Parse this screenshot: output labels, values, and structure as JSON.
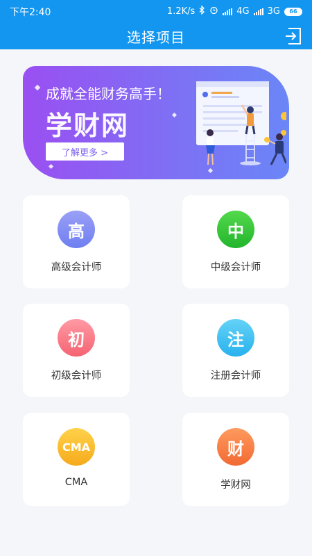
{
  "status": {
    "time": "下午2:40",
    "speed": "1.2K/s",
    "net1": "4G",
    "net2": "3G",
    "battery": "66"
  },
  "header": {
    "title": "选择项目"
  },
  "banner": {
    "headline": "成就全能财务高手！",
    "brand": "学财网",
    "button_label": "了解更多 >"
  },
  "items": [
    {
      "label": "高级会计师",
      "glyph": "高",
      "color_top": "#9aa0f6",
      "color_bottom": "#6f7ff2"
    },
    {
      "label": "中级会计师",
      "glyph": "中",
      "color_top": "#54d94c",
      "color_bottom": "#22b52c"
    },
    {
      "label": "初级会计师",
      "glyph": "初",
      "color_top": "#ff9aa4",
      "color_bottom": "#f56372"
    },
    {
      "label": "注册会计师",
      "glyph": "注",
      "color_top": "#64d2f6",
      "color_bottom": "#28b2ee"
    },
    {
      "label": "CMA",
      "glyph": "CMA",
      "color_top": "#ffd24a",
      "color_bottom": "#f6aa1c"
    },
    {
      "label": "学财网",
      "glyph": "财",
      "color_top": "#ff9a5e",
      "color_bottom": "#f26a33"
    }
  ],
  "colors": {
    "primary": "#1296f0",
    "background": "#f4f6f9"
  }
}
